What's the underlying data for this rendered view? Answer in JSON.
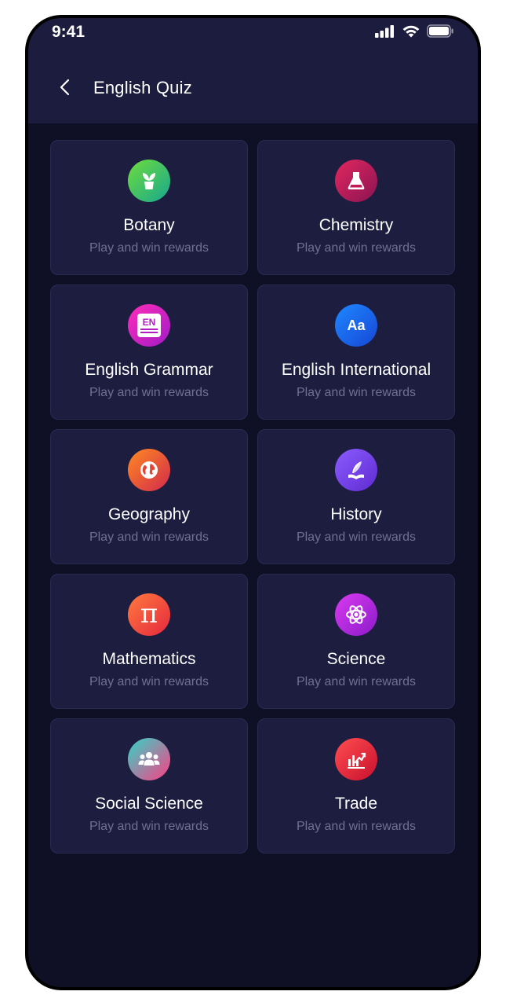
{
  "status": {
    "time": "9:41"
  },
  "header": {
    "title": "English Quiz"
  },
  "categories": [
    {
      "name": "Botany",
      "subtitle": "Play and win rewards",
      "icon": "plant-pot-icon"
    },
    {
      "name": "Chemistry",
      "subtitle": "Play and win rewards",
      "icon": "flask-icon"
    },
    {
      "name": "English Grammar",
      "subtitle": "Play and win rewards",
      "icon": "en-book-icon"
    },
    {
      "name": "English International",
      "subtitle": "Play and win rewards",
      "icon": "aa-text-icon"
    },
    {
      "name": "Geography",
      "subtitle": "Play and win rewards",
      "icon": "globe-icon"
    },
    {
      "name": "History",
      "subtitle": "Play and win rewards",
      "icon": "quill-book-icon"
    },
    {
      "name": "Mathematics",
      "subtitle": "Play and win rewards",
      "icon": "pi-icon"
    },
    {
      "name": "Science",
      "subtitle": "Play and win rewards",
      "icon": "atom-icon"
    },
    {
      "name": "Social Science",
      "subtitle": "Play and win rewards",
      "icon": "people-group-icon"
    },
    {
      "name": "Trade",
      "subtitle": "Play and win rewards",
      "icon": "trade-chart-icon"
    }
  ],
  "icon_texts": {
    "en": "EN",
    "aa": "Aa",
    "pi": "π"
  }
}
